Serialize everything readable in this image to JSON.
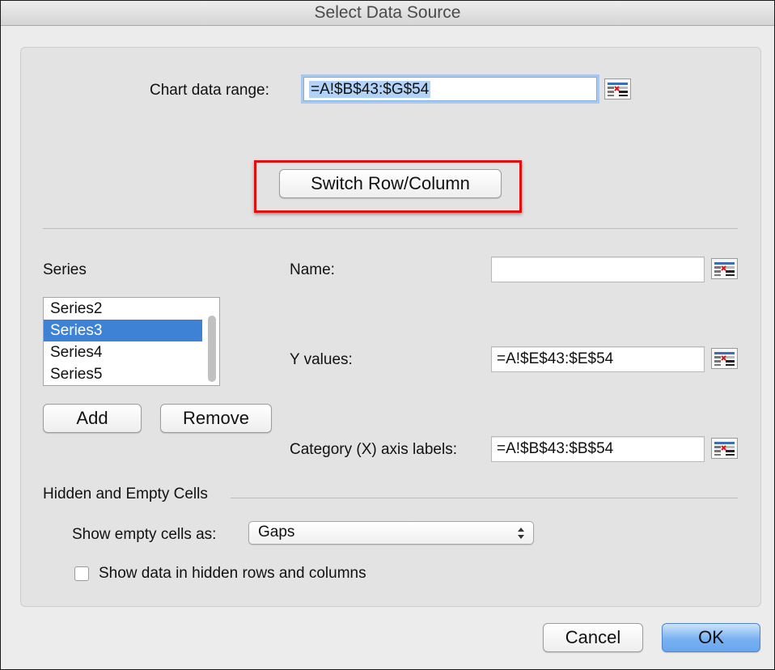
{
  "window": {
    "title": "Select Data Source"
  },
  "chart_data_range": {
    "label": "Chart data range:",
    "value": "=A!$B$43:$G$54"
  },
  "switch_button": {
    "label": "Switch Row/Column"
  },
  "series": {
    "label": "Series",
    "items": [
      "Series2",
      "Series3",
      "Series4",
      "Series5"
    ],
    "selected": "Series3",
    "add_label": "Add",
    "remove_label": "Remove"
  },
  "name_field": {
    "label": "Name:",
    "value": ""
  },
  "y_values": {
    "label": "Y values:",
    "value": "=A!$E$43:$E$54"
  },
  "category_labels": {
    "label": "Category (X) axis labels:",
    "value": "=A!$B$43:$B$54"
  },
  "hidden_empty": {
    "heading": "Hidden and Empty Cells",
    "show_empty_label": "Show empty cells as:",
    "show_empty_value": "Gaps",
    "show_hidden_label": "Show data in hidden rows and columns",
    "show_hidden_checked": false
  },
  "footer": {
    "cancel_label": "Cancel",
    "ok_label": "OK"
  },
  "colors": {
    "highlight": "#e10f0f",
    "selection": "#3e82d6",
    "primary_button": "#78b1f2"
  },
  "icons": {
    "range_picker": "collapse-dialog-icon",
    "popup": "updown-arrows-icon"
  }
}
